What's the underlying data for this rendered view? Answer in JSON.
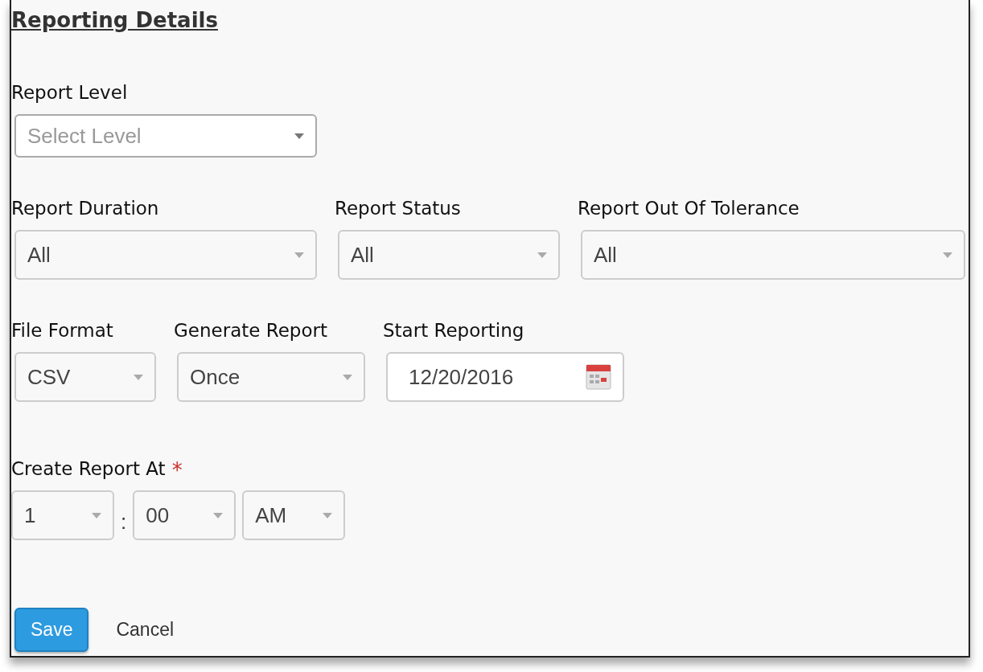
{
  "section_title": "Reporting Details",
  "rows": [
    {
      "fields": [
        {
          "kind": "select",
          "label": "Report Level",
          "placeholder": "Select Level"
        }
      ]
    },
    {
      "fields": [
        {
          "kind": "select",
          "label": "Report Duration",
          "value": "All"
        },
        {
          "kind": "select",
          "label": "Report Status",
          "value": "All"
        },
        {
          "kind": "select",
          "label": "Report Out Of Tolerance",
          "value": "All"
        }
      ]
    },
    {
      "fields": [
        {
          "kind": "select",
          "label": "File Format",
          "value": "CSV"
        },
        {
          "kind": "select",
          "label": "Generate Report",
          "value": "Once"
        },
        {
          "kind": "date",
          "label": "Start Reporting",
          "value": "12/20/2016"
        }
      ]
    }
  ],
  "create_report_at": {
    "label": "Create Report At",
    "required_mark": "*",
    "hour": "1",
    "separator": ":",
    "minute": "00",
    "meridiem": "AM"
  },
  "buttons": [
    {
      "label": "Save",
      "kind": "primary"
    },
    {
      "label": "Cancel",
      "kind": "link"
    }
  ]
}
